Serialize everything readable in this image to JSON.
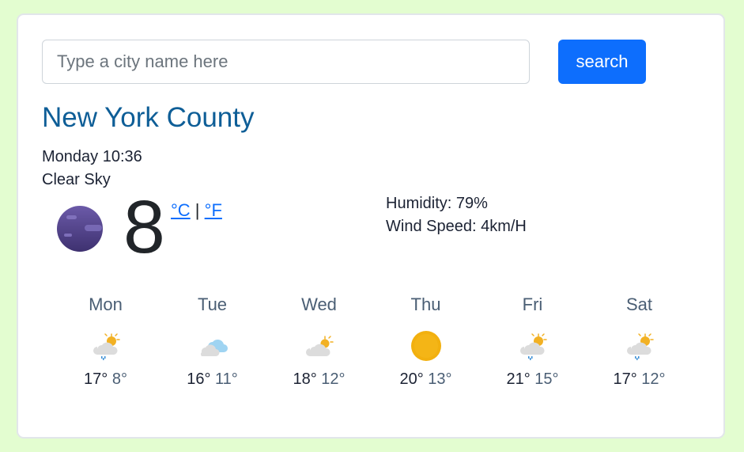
{
  "search": {
    "placeholder": "Type a city name here",
    "value": "",
    "button_label": "search"
  },
  "current": {
    "city": "New York County",
    "datetime": "Monday 10:36",
    "description": "Clear Sky",
    "icon": "clear-night-icon",
    "temperature": "8",
    "unit_celsius": "°C",
    "unit_separator": " | ",
    "unit_fahrenheit": "°F",
    "humidity_label": "Humidity: 79%",
    "wind_label": "Wind Speed: 4km/H"
  },
  "forecast": [
    {
      "day": "Mon",
      "icon": "sun-cloud-rain-icon",
      "max": "17°",
      "min": "8°"
    },
    {
      "day": "Tue",
      "icon": "cloudy-icon",
      "max": "16°",
      "min": "11°"
    },
    {
      "day": "Wed",
      "icon": "partly-cloudy-icon",
      "max": "18°",
      "min": "12°"
    },
    {
      "day": "Thu",
      "icon": "sun-icon",
      "max": "20°",
      "min": "13°"
    },
    {
      "day": "Fri",
      "icon": "sun-cloud-rain-icon",
      "max": "21°",
      "min": "15°"
    },
    {
      "day": "Sat",
      "icon": "sun-cloud-rain-icon",
      "max": "17°",
      "min": "12°"
    }
  ],
  "colors": {
    "page_background": "#e3fdd0",
    "accent": "#0d6efd",
    "city_title": "#0e5e97"
  }
}
